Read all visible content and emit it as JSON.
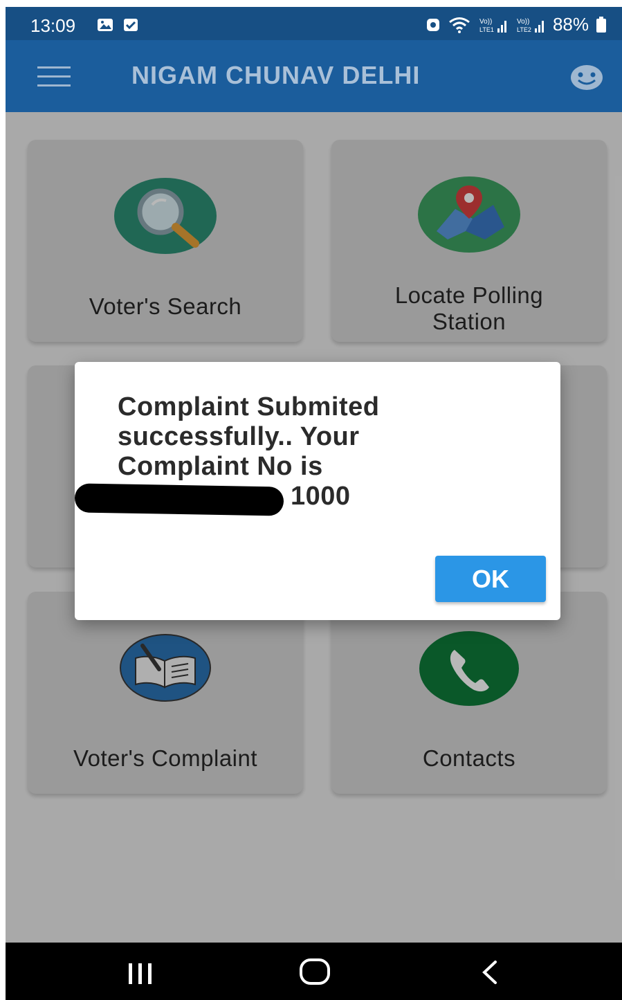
{
  "status_bar": {
    "time": "13:09",
    "battery": "88%",
    "icons": [
      "gallery-icon",
      "checkbox-icon",
      "screen-record-icon",
      "wifi-icon",
      "volte-lte1-signal-icon",
      "volte-lte2-signal-icon",
      "battery-icon"
    ]
  },
  "app_bar": {
    "title": "NIGAM CHUNAV DELHI",
    "menu_icon": "hamburger-menu-icon",
    "profile_icon": "face-icon"
  },
  "grid": {
    "items": [
      {
        "label": "Voter's Search",
        "icon": "magnifier-icon",
        "color": "#2d8f75"
      },
      {
        "label_line1": "Locate Polling",
        "label_line2": "Station",
        "icon": "map-pin-icon",
        "color": "#3ea062"
      },
      {
        "label": "Voter's Complaint",
        "icon": "open-book-pen-icon",
        "color": "#2c73b5"
      },
      {
        "label": "Contacts",
        "icon": "phone-icon",
        "color": "#0f7a3a"
      }
    ]
  },
  "dialog": {
    "message_line1": "Complaint Submited",
    "message_line2": "successfully.. Your",
    "message_line3": "Complaint No is",
    "complaint_no_visible": "1000",
    "ok_label": "OK",
    "ok_color": "#2b96e6"
  },
  "nav_bar": {
    "items": [
      "recent-apps-icon",
      "home-icon",
      "back-icon"
    ]
  }
}
